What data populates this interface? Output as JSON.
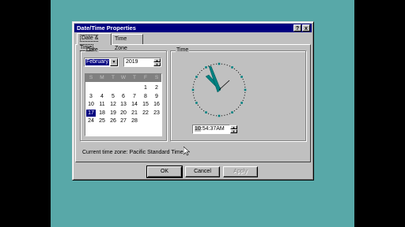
{
  "dialog": {
    "title": "Date/Time Properties",
    "help_label": "?",
    "close_label": "x"
  },
  "tabs": [
    {
      "label": "Date & Time"
    },
    {
      "label": "Time Zone"
    }
  ],
  "date_group": {
    "label": "Date",
    "month": "February",
    "year": "2019",
    "day_names": [
      "S",
      "M",
      "T",
      "W",
      "T",
      "F",
      "S"
    ],
    "weeks": [
      [
        "",
        "",
        "",
        "",
        "",
        "1",
        "2"
      ],
      [
        "3",
        "4",
        "5",
        "6",
        "7",
        "8",
        "9"
      ],
      [
        "10",
        "11",
        "12",
        "13",
        "14",
        "15",
        "16"
      ],
      [
        "17",
        "18",
        "19",
        "20",
        "21",
        "22",
        "23"
      ],
      [
        "24",
        "25",
        "26",
        "27",
        "28",
        "",
        ""
      ]
    ],
    "selected_day": "17"
  },
  "time_group": {
    "label": "Time",
    "time_hour": "10",
    "time_rest": ":54:37AM"
  },
  "timezone": {
    "text": "Current time zone:  Pacific Standard Time"
  },
  "buttons": {
    "ok": "OK",
    "cancel": "Cancel",
    "apply": "Apply"
  },
  "colors": {
    "desktop": "#58a8a8",
    "titlebar": "#000080",
    "face": "#c0c0c0",
    "clock_hands": "#008080"
  }
}
